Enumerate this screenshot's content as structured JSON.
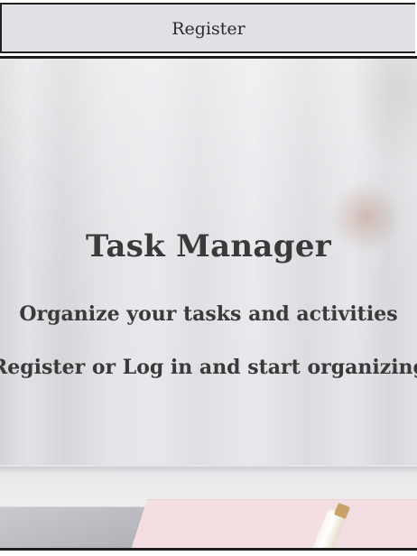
{
  "navbar": {
    "register_link": "Register"
  },
  "hero": {
    "title": "Task Manager",
    "subtitle": "Organize your tasks and activities",
    "cta_text": "Register or Log in and start organizing"
  },
  "colors": {
    "navbar_bg": "#e0e1e7",
    "text": "#3b3939",
    "border": "#1e1e1e"
  }
}
